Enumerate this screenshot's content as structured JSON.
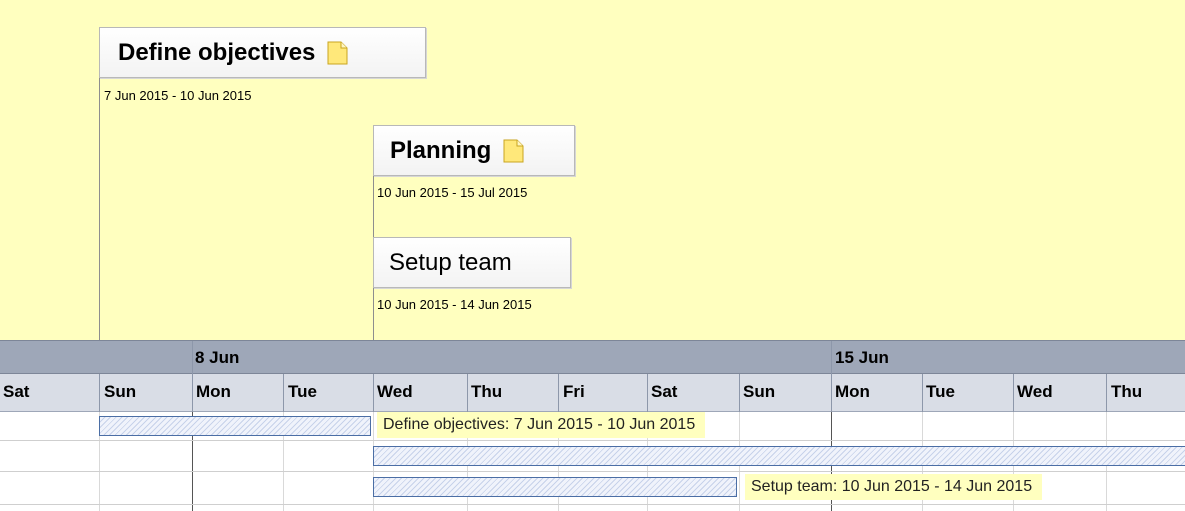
{
  "timeline": {
    "items": [
      {
        "id": "define",
        "title": "Define objectives",
        "dates": "7 Jun 2015 - 10 Jun 2015",
        "bold": true,
        "note_icon": "note-icon"
      },
      {
        "id": "planning",
        "title": "Planning",
        "dates": "10 Jun 2015 - 15 Jul 2015",
        "bold": true,
        "note_icon": "note-icon"
      },
      {
        "id": "setup",
        "title": "Setup team",
        "dates": "10 Jun 2015 - 14 Jun 2015",
        "bold": false
      }
    ]
  },
  "gantt": {
    "weeks": [
      "8 Jun",
      "15 Jun"
    ],
    "days": [
      "Sat",
      "Sun",
      "Mon",
      "Tue",
      "Wed",
      "Thu",
      "Fri",
      "Sat",
      "Sun",
      "Mon",
      "Tue",
      "Wed",
      "Thu"
    ],
    "rows": [
      {
        "label": "Define objectives: 7 Jun 2015 - 10 Jun 2015"
      },
      {
        "label": ""
      },
      {
        "label": "Setup team: 10 Jun 2015 - 14 Jun 2015"
      }
    ]
  },
  "colors": {
    "timeline_bg": "#ffffbf",
    "week_header_bg": "#9ea7b8",
    "day_header_bg": "#d9dde6",
    "bar_border": "#4b6ea5"
  }
}
